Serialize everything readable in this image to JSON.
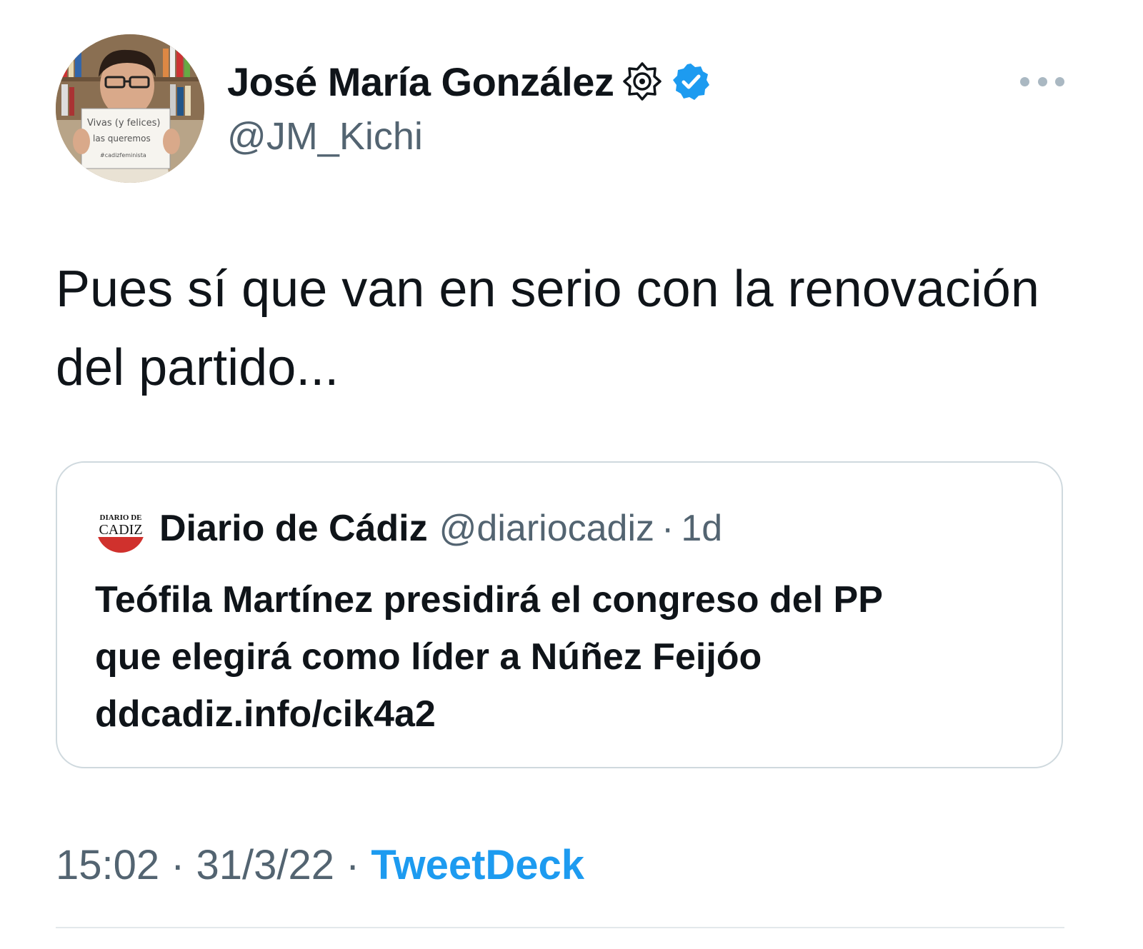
{
  "author": {
    "display_name": "José María González",
    "handle": "@JM_Kichi",
    "avatar_sign_lines": [
      "Vivas (y felices)",
      "las queremos",
      "#cadizfeminista"
    ],
    "badges": [
      "affiliate-badge-icon",
      "verified-badge-icon"
    ],
    "verified_color": "#1d9bf0"
  },
  "more_icon": "more-dots-icon",
  "tweet": {
    "text": "Pues sí que van en serio con la renovación del partido..."
  },
  "quoted_tweet": {
    "logo_text_top": "DIARIO DE",
    "logo_text_bottom": "CADIZ",
    "display_name": "Diario de Cádiz",
    "handle": "@diariocadiz",
    "separator": "·",
    "time": "1d",
    "text_line1": "Teófila Martínez presidirá el congreso del PP",
    "text_line2": "que elegirá como líder a Núñez Feijóo",
    "link": "ddcadiz.info/cik4a2"
  },
  "meta": {
    "time": "15:02",
    "date": "31/3/22",
    "separator": "·",
    "source": "TweetDeck"
  },
  "colors": {
    "text_primary": "#0f1419",
    "text_secondary": "#536471",
    "accent": "#1d9bf0",
    "border": "#cfd9de"
  }
}
